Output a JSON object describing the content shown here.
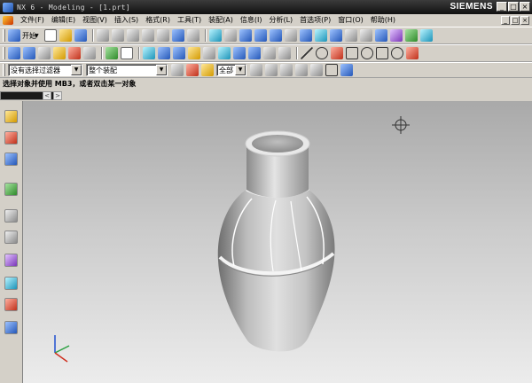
{
  "window": {
    "title": "NX 6 - Modeling - [1.prt]",
    "brand": "SIEMENS",
    "controls": [
      "_",
      "□",
      "×"
    ]
  },
  "menubar": {
    "items": [
      "文件(F)",
      "编辑(E)",
      "视图(V)",
      "插入(S)",
      "格式(R)",
      "工具(T)",
      "装配(A)",
      "信息(I)",
      "分析(L)",
      "首选项(P)",
      "窗口(O)",
      "帮助(H)"
    ],
    "doc_controls": [
      "_",
      "□",
      "×"
    ]
  },
  "toolbar_standard": {
    "start_label": "开始"
  },
  "selection_bar": {
    "filter_value": "没有选择过滤器",
    "scope_value": "整个装配",
    "snap_value": "全部"
  },
  "prompt": {
    "text": "选择对象并使用 MB3，或者双击某一对象"
  },
  "tabs": {
    "prev": "<",
    "next": ">"
  },
  "icons": {
    "resource_bar": [
      "assembly-navigator-icon",
      "constraint-navigator-icon",
      "part-navigator-icon",
      "reuse-library-icon",
      "history-icon",
      "system-materials-icon",
      "palette-icon",
      "process-studio-icon",
      "roles-icon",
      "web-browser-icon"
    ],
    "accent_colors": {
      "title_bg": "#111111",
      "axis_x": "#d03020",
      "axis_y": "#2aa040",
      "axis_z": "#2050d0"
    }
  }
}
